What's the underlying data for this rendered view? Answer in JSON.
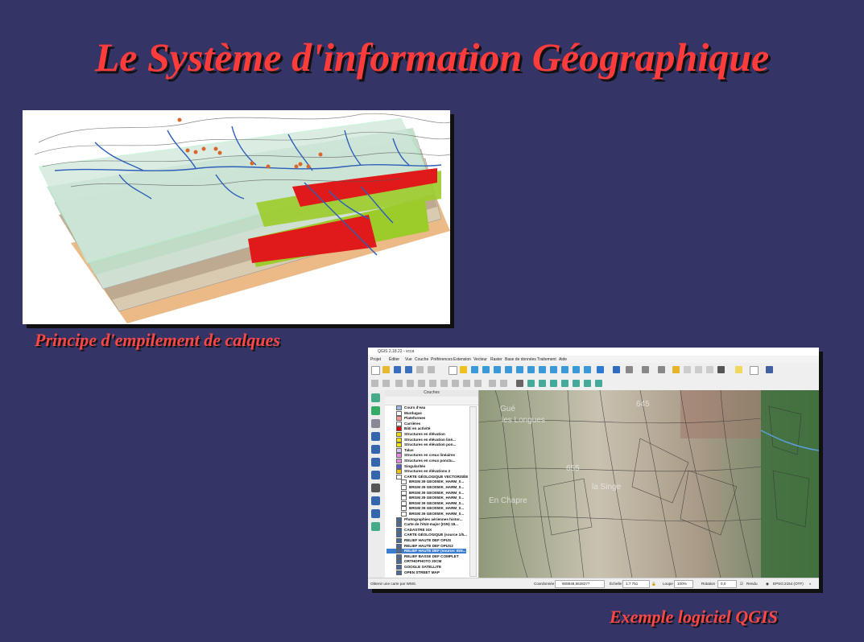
{
  "slide": {
    "title": "Le Système d'information Géographique",
    "caption_left": "Principe d'empilement de calques",
    "caption_right": "Exemple logiciel QGIS"
  },
  "qgis": {
    "window_title": "QGIS 2.18.22 - vcca",
    "menu": [
      "Projet",
      "Éditer",
      "Vue",
      "Couche",
      "Préférences",
      "Extension",
      "Vecteur",
      "Raster",
      "Base de données",
      "Traitement",
      "Aide"
    ],
    "panel_title": "Couches",
    "layers": [
      {
        "label": "Cours d'eau",
        "color": "#9ab8e8"
      },
      {
        "label": "Murdugas",
        "color": "#ffffff"
      },
      {
        "label": "Plateformes",
        "color": "#ff9999"
      },
      {
        "label": "Carrières",
        "color": "#ffffff"
      },
      {
        "label": "Bâti en activité",
        "color": "#e00000"
      },
      {
        "label": "Structures en élévation",
        "color": "#e6d800"
      },
      {
        "label": "Structures en élévation liné...",
        "color": "#f5e100"
      },
      {
        "label": "Structures en élévation pon...",
        "color": "#f5e100"
      },
      {
        "label": "Talus",
        "color": "#d9c4ff"
      },
      {
        "label": "Structures en creux linéaires",
        "color": "#e48ae4"
      },
      {
        "label": "Structures en creux ponctu...",
        "color": "#e48ae4"
      },
      {
        "label": "Singularités",
        "color": "#5a5acf"
      },
      {
        "label": "Structures en élévations 2",
        "color": "#f5c400"
      },
      {
        "label": "CARTE GÉOLOGIQUE VECTORISÉE",
        "color": "#ffffff"
      },
      {
        "label": "BRGM 39 GEO050K_HARM_0...",
        "color": "#ffffff"
      },
      {
        "label": "BRGM 39 GEO050K_HARM_0...",
        "color": "#ffffff"
      },
      {
        "label": "BRGM 39 GEO050K_HARM_0...",
        "color": "#ffffff"
      },
      {
        "label": "BRGM 39 GEO050K_HARM_0...",
        "color": "#ffffff"
      },
      {
        "label": "BRGM 39 GEO050K_HARM_0...",
        "color": "#ffffff"
      },
      {
        "label": "BRGM 39 GEO050K_HARM_0...",
        "color": "#ffffff"
      },
      {
        "label": "BRGM 39 GEO050K_HARM_0...",
        "color": "#ffffff"
      },
      {
        "label": "Photographies aériennes histor...",
        "color": "#4a6a9a"
      },
      {
        "label": "Carte de l'état-major (IGN) 18...",
        "color": "#4a6a9a"
      },
      {
        "label": "CADASTRE XIX",
        "color": "#4a6a9a"
      },
      {
        "label": "CARTE GÉOLOGIQUE (source 1/5...",
        "color": "#4a6a9a"
      },
      {
        "label": "RELIEF HAUTE DEF OPUS",
        "color": "#4a6a9a"
      },
      {
        "label": "RELIEF HAUTE DEF OPUS2",
        "color": "#4a6a9a"
      },
      {
        "label": "RELIEF HAUTE DEF (source: IGN...",
        "color": "#4a6a9a"
      },
      {
        "label": "RELIEF BASSE DEF COMPLET",
        "color": "#4a6a9a"
      },
      {
        "label": "ORTHOPHOTO 20CM",
        "color": "#4a6a9a"
      },
      {
        "label": "GOOGLE SATELLITE",
        "color": "#4a6a9a"
      },
      {
        "label": "OPEN STREET MAP",
        "color": "#4a6a9a"
      }
    ],
    "selected_layer_index": 27,
    "map_labels": [
      "Gué",
      "les Longues",
      "En Chapre",
      "la Singe",
      "655",
      "645"
    ],
    "status": {
      "message": "Obtenir une carte par WMS.",
      "coord_label": "Coordonnée",
      "coord_value": "908848,6628277",
      "scale_label": "Échelle",
      "scale_value": "1:7 751",
      "zoom_label": "Loupe",
      "zoom_value": "100%",
      "rotation_label": "Rotation",
      "rotation_value": "0,0",
      "render_label": "Rendu",
      "crs": "EPSG:2154 (OTF)"
    }
  }
}
